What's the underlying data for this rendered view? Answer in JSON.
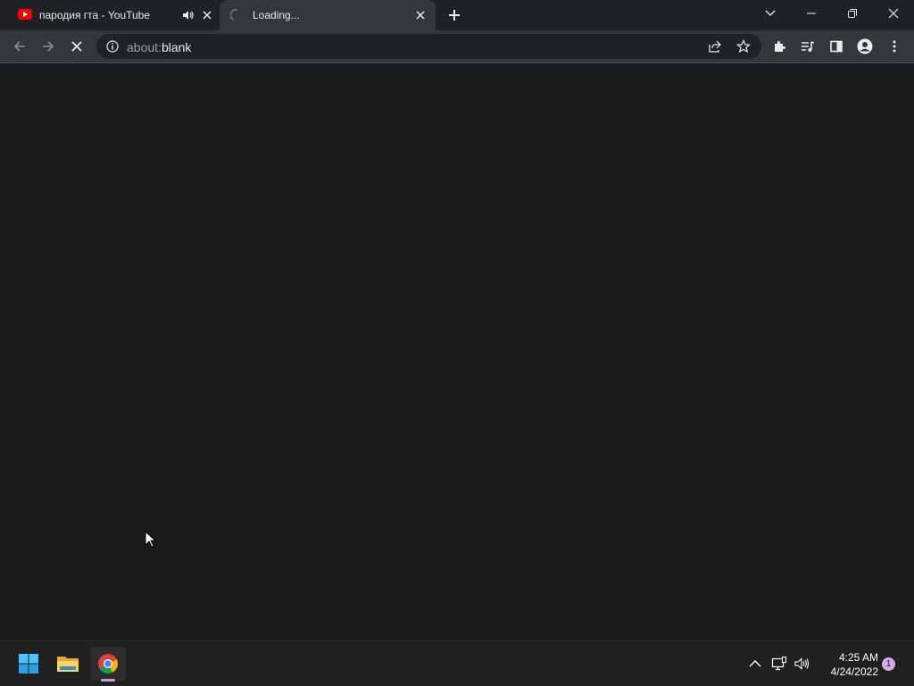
{
  "tabs": [
    {
      "title": "пародия гта - YouTube",
      "favicon": "youtube-icon",
      "audio": "audio-playing-icon"
    },
    {
      "title": "Loading...",
      "favicon": "loading-spinner-icon"
    }
  ],
  "window_controls": [
    "tab-search-icon",
    "minimize-icon",
    "restore-icon",
    "close-icon"
  ],
  "toolbar": {
    "back": "back-arrow-icon",
    "forward": "forward-arrow-icon",
    "stop": "stop-loading-icon",
    "url_scheme": "about:",
    "url_host": "blank",
    "right_icons": [
      "share-icon",
      "bookmark-star-icon",
      "extensions-icon",
      "media-controls-icon",
      "side-panel-icon",
      "profile-icon",
      "menu-icon"
    ]
  },
  "taskbar": {
    "apps": [
      "windows-start-icon",
      "file-explorer-icon",
      "chrome-icon"
    ],
    "tray": [
      "show-hidden-icons-icon",
      "network-icon",
      "volume-icon"
    ],
    "time": "4:25 AM",
    "date": "4/24/2022",
    "notifications": "1"
  },
  "colors": {
    "tabstrip_bg": "#202124",
    "toolbar_bg": "#35363a",
    "content_bg": "#1b1b1b",
    "taskbar_bg": "#202020",
    "youtube_red": "#ff0000",
    "badge": "#d6a8e8"
  }
}
